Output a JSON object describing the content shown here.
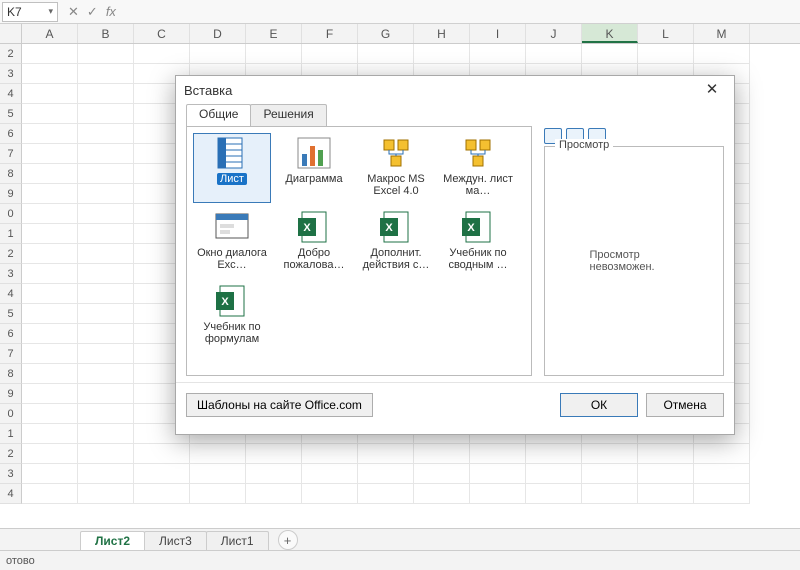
{
  "namebox": {
    "value": "K7"
  },
  "fx": {
    "cancel": "✕",
    "accept": "✓",
    "label": "fx"
  },
  "columns": [
    "A",
    "B",
    "C",
    "D",
    "E",
    "F",
    "G",
    "H",
    "I",
    "J",
    "K",
    "L",
    "M"
  ],
  "selected_col": "K",
  "row_labels": [
    "2",
    "3",
    "4",
    "5",
    "6",
    "7",
    "8",
    "9",
    "0",
    "1",
    "2",
    "3",
    "4",
    "5",
    "6",
    "7",
    "8",
    "9",
    "0",
    "1",
    "2",
    "3",
    "4"
  ],
  "sheet_tabs": {
    "items": [
      "Лист2",
      "Лист3",
      "Лист1"
    ],
    "active": 0,
    "add": "+"
  },
  "status": {
    "text": "отово"
  },
  "dialog": {
    "title": "Вставка",
    "close": "✕",
    "tabs": [
      "Общие",
      "Решения"
    ],
    "active_tab": 0,
    "templates": [
      {
        "label": "Лист",
        "icon": "sheet",
        "selected": true
      },
      {
        "label": "Диаграмма",
        "icon": "chart",
        "selected": false
      },
      {
        "label": "Макрос MS Excel 4.0",
        "icon": "macro",
        "selected": false
      },
      {
        "label": "Междун. лист ма…",
        "icon": "macro2",
        "selected": false
      },
      {
        "label": "Окно диалога Exc…",
        "icon": "dlg",
        "selected": false
      },
      {
        "label": "Добро пожалова…",
        "icon": "xl",
        "selected": false
      },
      {
        "label": "Дополнит. действия с…",
        "icon": "xl",
        "selected": false
      },
      {
        "label": "Учебник по сводным …",
        "icon": "xl",
        "selected": false
      },
      {
        "label": "Учебник по формулам",
        "icon": "xl",
        "selected": false
      }
    ],
    "preview_label": "Просмотр",
    "preview_msg": "Просмотр невозможен.",
    "office_btn": "Шаблоны на сайте Office.com",
    "ok": "ОК",
    "cancel": "Отмена"
  }
}
